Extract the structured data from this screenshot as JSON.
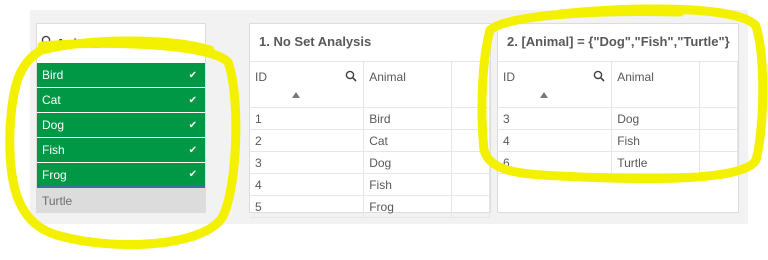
{
  "filter": {
    "title": "Animal",
    "items": [
      {
        "label": "Bird",
        "state": "selected"
      },
      {
        "label": "Cat",
        "state": "selected"
      },
      {
        "label": "Dog",
        "state": "selected"
      },
      {
        "label": "Fish",
        "state": "selected"
      },
      {
        "label": "Frog",
        "state": "selected"
      },
      {
        "label": "Turtle",
        "state": "excluded"
      }
    ],
    "check_glyph": "✔"
  },
  "table1": {
    "title": "1. No Set Analysis",
    "columns": [
      "ID",
      "Animal"
    ],
    "rows": [
      [
        "1",
        "Bird"
      ],
      [
        "2",
        "Cat"
      ],
      [
        "3",
        "Dog"
      ],
      [
        "4",
        "Fish"
      ],
      [
        "5",
        "Frog"
      ]
    ]
  },
  "table2": {
    "title": "2. [Animal] = {\"Dog\",\"Fish\",\"Turtle\"}",
    "columns": [
      "ID",
      "Animal"
    ],
    "rows": [
      [
        "3",
        "Dog"
      ],
      [
        "4",
        "Fish"
      ],
      [
        "6",
        "Turtle"
      ]
    ]
  },
  "colors": {
    "selected": "#009845",
    "excluded": "#dcdcdc",
    "highlight": "#f3f000"
  }
}
